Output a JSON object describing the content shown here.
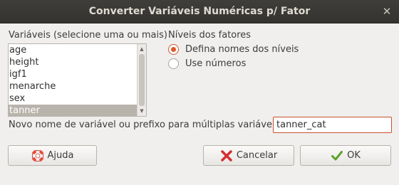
{
  "window": {
    "title": "Converter Variáveis Numéricas p/ Fator",
    "close_glyph": "✕"
  },
  "variables": {
    "label": "Variáveis (selecione uma ou mais)",
    "items": [
      "age",
      "height",
      "igf1",
      "menarche",
      "sex",
      "tanner"
    ],
    "selected": "tanner"
  },
  "factor_levels": {
    "label": "Níveis dos fatores",
    "options": [
      {
        "label": "Defina nomes dos níveis",
        "checked": true
      },
      {
        "label": "Use números",
        "checked": false
      }
    ]
  },
  "new_name": {
    "label": "Novo nome de variável ou prefixo para múltiplas variáveis:",
    "value": "tanner_cat"
  },
  "buttons": {
    "help": {
      "label": "Ajuda",
      "icon": "lifebuoy-icon"
    },
    "cancel": {
      "label": "Cancelar",
      "icon": "red-x-icon"
    },
    "ok": {
      "label": "OK",
      "icon": "green-check-icon"
    }
  },
  "colors": {
    "titlebar": "#3b3a36",
    "accent": "#e0582a",
    "selection": "#b9b4ab"
  }
}
